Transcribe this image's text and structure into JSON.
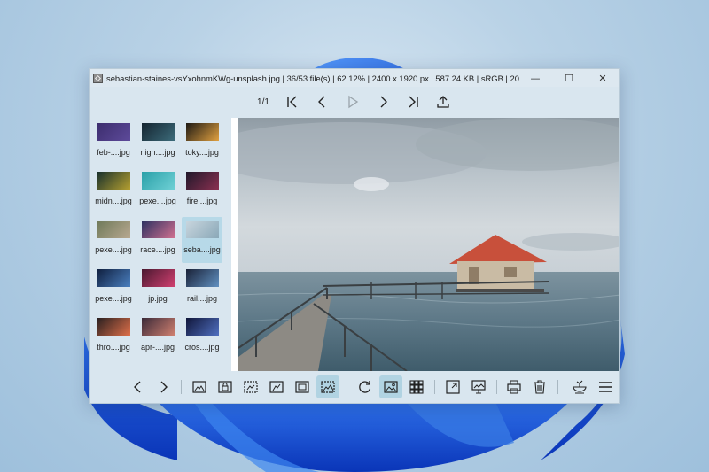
{
  "window": {
    "title": "sebastian-staines-vsYxohnmKWg-unsplash.jpg  |  36/53 file(s)  |  62.12%  |  2400 x 1920 px  |  587.24 KB  |  sRGB  |  20..."
  },
  "nav": {
    "page_count": "1/1"
  },
  "thumbnails": [
    {
      "label": "feb-....jpg"
    },
    {
      "label": "nigh....jpg"
    },
    {
      "label": "toky....jpg"
    },
    {
      "label": "midn....jpg"
    },
    {
      "label": "pexe....jpg"
    },
    {
      "label": "fire....jpg"
    },
    {
      "label": "pexe....jpg"
    },
    {
      "label": "race....jpg"
    },
    {
      "label": "seba....jpg"
    },
    {
      "label": "pexe....jpg"
    },
    {
      "label": "jp.jpg"
    },
    {
      "label": "rail....jpg"
    },
    {
      "label": "thro....jpg"
    },
    {
      "label": "apr-....jpg"
    },
    {
      "label": "cros....jpg"
    }
  ],
  "selected_thumbnail": 8,
  "colors": {
    "accent": "#b1d3e2",
    "window_bg": "#d9e6ef"
  }
}
